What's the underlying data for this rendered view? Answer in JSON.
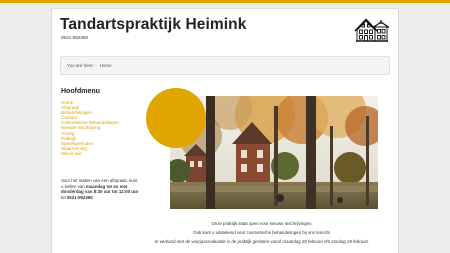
{
  "colors": {
    "accent": "#e0a800",
    "link": "#e0a000",
    "background": "#ececec"
  },
  "header": {
    "title": "Tandartspraktijk Heimink",
    "phone": "0521-592360",
    "logo_icon": "house-drawing-icon"
  },
  "breadcrumb": {
    "prefix": "You are here:",
    "current": "Home"
  },
  "sidebar": {
    "heading": "Hoofdmenu",
    "items": [
      "Home",
      "Afspraak",
      "Behandelingen",
      "Contact",
      "Cosmetische behandelingen",
      "Nieuwe inschrijving",
      "Overig",
      "Praktijk",
      "Spreekperioden",
      "Waarneming",
      "Wie is wie"
    ],
    "appointment": {
      "text1": "Voor het maken van een afspraak, kunt u bellen van ",
      "bold1": "maandag tot en met donderdag van 8:30 uur tot 12:00 uur",
      "text2": " tel ",
      "bold2": "0521-592360"
    }
  },
  "main": {
    "caption1": "Onze praktijk staat open voor nieuwe inschrijvingen.",
    "caption2": "Ook kunt u uitstekend voor cosmetische behandelingen bij ons terecht.",
    "caption3": "In verband met de voorjaarsvakantie is de praktijk gesloten vanaf maandag 20 februari t/m zondag 26 februari."
  }
}
